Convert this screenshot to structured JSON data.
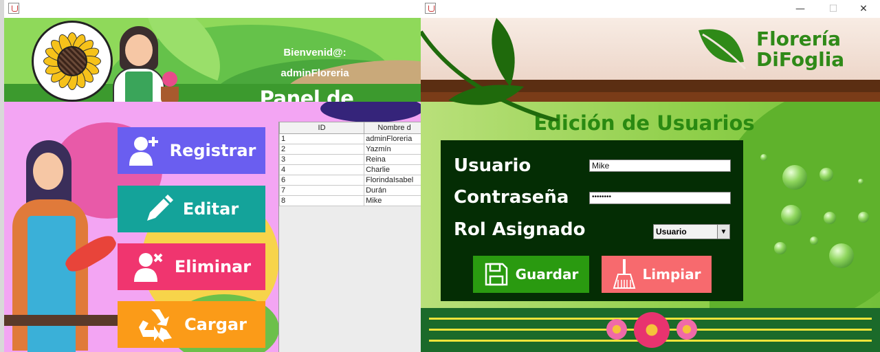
{
  "left_window": {
    "welcome_line1": "Bienvenid@:",
    "welcome_line2": "adminFloreria",
    "panel_title": "Panel de Admins",
    "buttons": {
      "registrar": "Registrar",
      "editar": "Editar",
      "eliminar": "Eliminar",
      "cargar": "Cargar"
    },
    "table": {
      "headers": [
        "ID",
        "Nombre d"
      ],
      "rows": [
        [
          "1",
          "adminFloreria"
        ],
        [
          "2",
          "Yazmín"
        ],
        [
          "3",
          "Reina"
        ],
        [
          "4",
          "Charlie"
        ],
        [
          "6",
          "FlorindaIsabel"
        ],
        [
          "7",
          "Durán"
        ],
        [
          "8",
          "Mike"
        ]
      ]
    }
  },
  "right_window": {
    "window_controls": {
      "minimize": "—",
      "maximize": "☐",
      "close": "✕"
    },
    "brand_line1": "Florería",
    "brand_line2": "DiFoglia",
    "form_title": "Edición de Usuarios",
    "labels": {
      "usuario": "Usuario",
      "contrasena": "Contraseña",
      "rol": "Rol Asignado"
    },
    "usuario_value": "Mike",
    "contrasena_value": "••••••••",
    "rol_selected": "Usuario",
    "buttons": {
      "guardar": "Guardar",
      "limpiar": "Limpiar"
    }
  },
  "colors": {
    "registrar": "#6a5ef0",
    "editar": "#14a39a",
    "eliminar": "#f0356f",
    "cargar": "#fb9b18",
    "guardar": "#2a9a10",
    "limpiar": "#f76a6e",
    "form_bg": "#042d04",
    "title_green": "#2a8a12"
  }
}
